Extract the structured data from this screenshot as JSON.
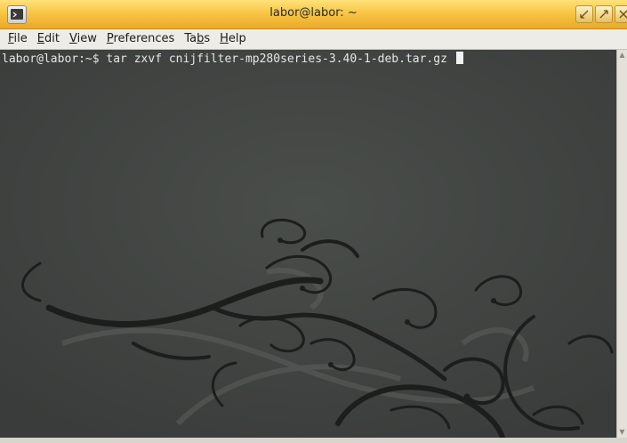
{
  "window": {
    "title": "labor@labor: ~",
    "buttons": [
      "minimize",
      "maximize",
      "close"
    ]
  },
  "menu": [
    {
      "pre": "",
      "mn": "F",
      "post": "ile"
    },
    {
      "pre": "",
      "mn": "E",
      "post": "dit"
    },
    {
      "pre": "",
      "mn": "V",
      "post": "iew"
    },
    {
      "pre": "",
      "mn": "P",
      "post": "references"
    },
    {
      "pre": "Ta",
      "mn": "b",
      "post": "s"
    },
    {
      "pre": "",
      "mn": "H",
      "post": "elp"
    }
  ],
  "terminal": {
    "prompt": "labor@labor:~$ ",
    "command": "tar zxvf cnijfilter-mp280series-3.40-1-deb.tar.gz "
  },
  "colors": {
    "titlebar": "#f7c646",
    "terminal_bg": "#3f4340",
    "terminal_fg": "#e6e6e6"
  },
  "icons": {
    "app": "terminal-app-icon",
    "minimize": "minimize-icon",
    "maximize": "maximize-icon",
    "close": "close-icon"
  }
}
